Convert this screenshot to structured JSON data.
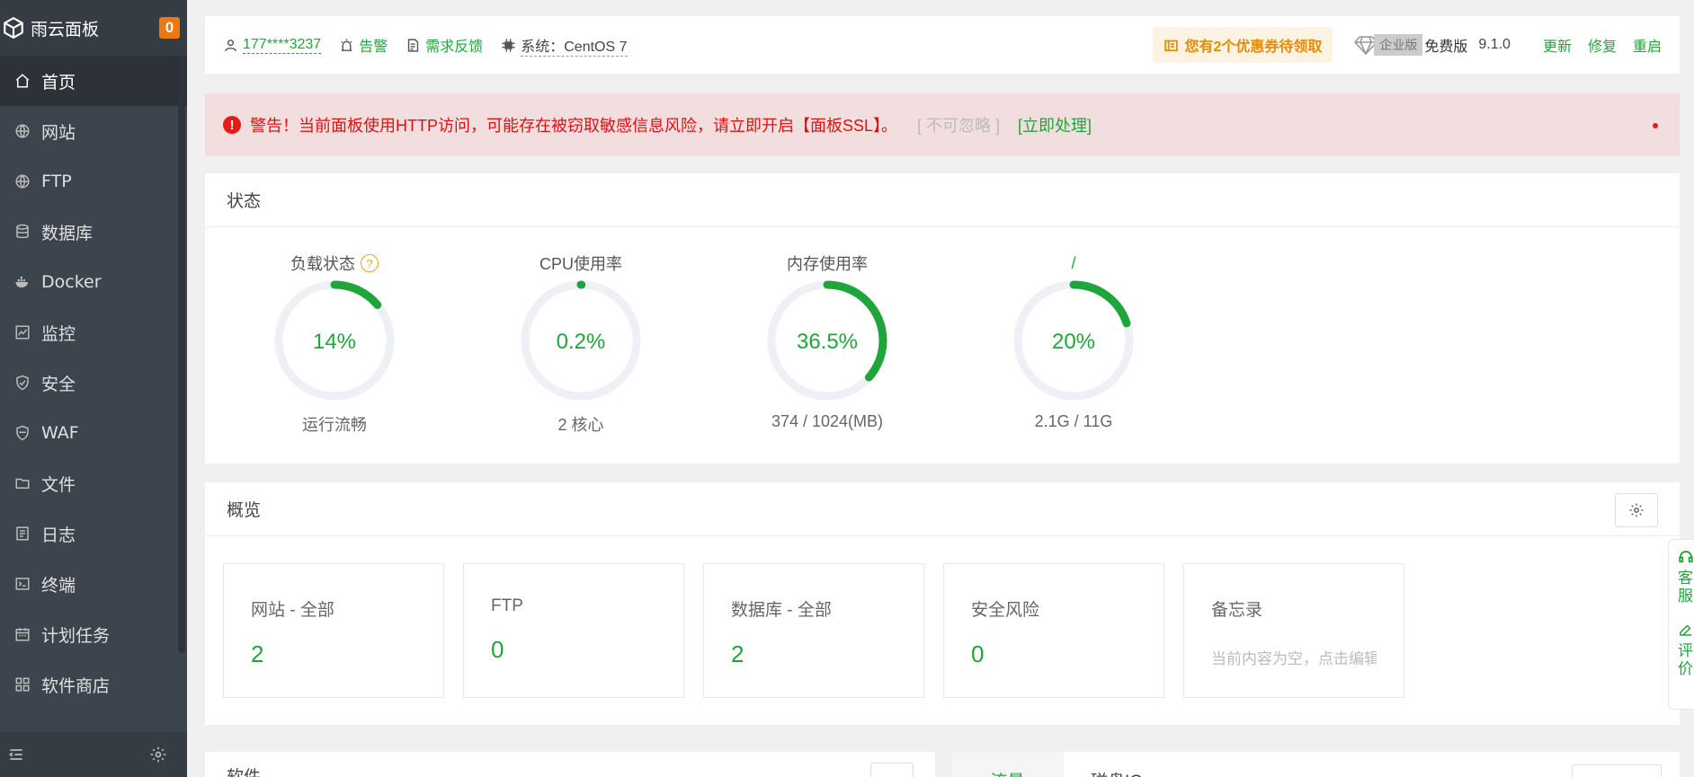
{
  "sidebar": {
    "brand_title": "雨云面板",
    "badge_count": "0",
    "items": [
      {
        "label": "首页",
        "icon": "home-icon",
        "active": true
      },
      {
        "label": "网站",
        "icon": "globe-icon"
      },
      {
        "label": "FTP",
        "icon": "globe-icon"
      },
      {
        "label": "数据库",
        "icon": "database-icon"
      },
      {
        "label": "Docker",
        "icon": "docker-icon"
      },
      {
        "label": "监控",
        "icon": "monitor-icon"
      },
      {
        "label": "安全",
        "icon": "shield-icon"
      },
      {
        "label": "WAF",
        "icon": "waf-icon"
      },
      {
        "label": "文件",
        "icon": "folder-icon"
      },
      {
        "label": "日志",
        "icon": "log-icon"
      },
      {
        "label": "终端",
        "icon": "terminal-icon"
      },
      {
        "label": "计划任务",
        "icon": "calendar-icon"
      },
      {
        "label": "软件商店",
        "icon": "apps-icon"
      }
    ]
  },
  "topbar": {
    "user": "177****3237",
    "alarm": "告警",
    "feedback": "需求反馈",
    "system": "系统：CentOS 7",
    "coupon": "您有2个优惠券待领取",
    "enterprise": "企业版",
    "free": "免费版",
    "version": "9.1.0",
    "update": "更新",
    "repair": "修复",
    "restart": "重启"
  },
  "alert": {
    "message": "警告！当前面板使用HTTP访问，可能存在被窃取敏感信息风险，请立即开启【面板SSL】。",
    "ignore": "[ 不可忽略 ]",
    "fix": "[立即处理]"
  },
  "status": {
    "title": "状态",
    "gauges": [
      {
        "title": "负载状态",
        "value": "14%",
        "percent": 14,
        "sub": "运行流畅",
        "help": "?"
      },
      {
        "title": "CPU使用率",
        "value": "0.2%",
        "percent": 0.2,
        "sub": "2 核心"
      },
      {
        "title": "内存使用率",
        "value": "36.5%",
        "percent": 36.5,
        "sub": "374 / 1024(MB)"
      },
      {
        "title": "/",
        "value": "20%",
        "percent": 20,
        "sub": "2.1G / 11G"
      }
    ]
  },
  "overview": {
    "title": "概览",
    "cards": [
      {
        "label": "网站 - 全部",
        "value": "2"
      },
      {
        "label": "FTP",
        "value": "0"
      },
      {
        "label": "数据库 - 全部",
        "value": "2"
      },
      {
        "label": "安全风险",
        "value": "0"
      },
      {
        "label": "备忘录",
        "hint": "当前内容为空，点击编辑"
      }
    ]
  },
  "float_bar": {
    "service": "客服",
    "review": "评价"
  },
  "bottom": {
    "software_title": "软件",
    "tab_traffic": "流量",
    "tab_disk": "磁盘IO"
  },
  "colors": {
    "accent": "#20a53a",
    "sidebar": "#3c444d",
    "gauge_track": "#eef0f5",
    "warning": "#dd1111"
  }
}
